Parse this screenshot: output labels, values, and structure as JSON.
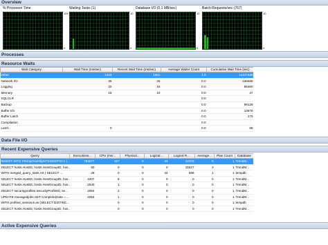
{
  "sections": {
    "overview": "Overview",
    "processes": "Processes",
    "resource_waits": "Resource Waits",
    "data_file_io": "Data File I/O",
    "recent_expensive_queries": "Recent Expensive Queries",
    "active_expensive_queries": "Active Expensive Queries"
  },
  "graphs": [
    {
      "title": "% Processor Time",
      "scale": [
        "100",
        "",
        "",
        "",
        "",
        "",
        "",
        "",
        "",
        "0"
      ],
      "color": "#00cc00"
    },
    {
      "title": "Waiting Tasks (1)",
      "scale": [
        "10",
        "",
        "",
        "",
        "",
        "",
        "",
        "",
        "",
        "0"
      ],
      "color": "#00cc00"
    },
    {
      "title": "Database I/O (0.1 MB/sec)",
      "scale": [
        "10",
        "",
        "",
        "",
        "",
        "",
        "",
        "",
        "",
        "0"
      ],
      "color": "#00cc00"
    },
    {
      "title": "Batch Requests/sec (767)",
      "scale": [
        "10",
        "",
        "",
        "",
        "",
        "",
        "",
        "",
        "",
        "0"
      ],
      "color": "#00cc00"
    }
  ],
  "resource_waits": {
    "columns": [
      "Wait Category",
      "Wait Time (ms/sec)",
      "Recent Wait Time (ms/sec)",
      "Average Waiter Count",
      "Cumulative Wait Time (sec)"
    ],
    "rows": [
      [
        "Other",
        "1003",
        "1001",
        "1.0",
        "12327639"
      ],
      [
        "Network I/O",
        "25",
        "26",
        "0.0",
        "166686"
      ],
      [
        "Logging",
        "20",
        "16",
        "0.0",
        "86480"
      ],
      [
        "Memory",
        "16",
        "10",
        "0.0",
        "47"
      ],
      [
        "SQLCLR",
        "",
        "",
        "0.0",
        ""
      ],
      [
        "Backup",
        "",
        "",
        "0.0",
        "99128"
      ],
      [
        "Buffer I/O",
        "",
        "",
        "0.0",
        "13676"
      ],
      [
        "Buffer Latch",
        "",
        "",
        "0.0",
        "175"
      ],
      [
        "Compilation",
        "",
        "",
        "0.0",
        ""
      ],
      [
        "Latch",
        "0",
        "",
        "0.0",
        "69"
      ]
    ]
  },
  "recent_queries": {
    "columns": [
      "Query",
      "Executions...",
      "CPU (ms/...",
      "Physical...",
      "Logical...",
      "Logical R...",
      "Average...",
      "Plan Count",
      "Database"
    ],
    "rows": [
      [
        "INSERT INTO #TempOneObjINTEGERPOC1 (...",
        "784677",
        "187",
        "0",
        "33",
        "12076",
        "0",
        "1",
        "TrendM..."
      ],
      [
        "SELECT hosts.HostID, hosts.HostGroupID, hos...",
        "60",
        "0",
        "0",
        "0",
        "15627",
        "3",
        "1",
        "TrendM..."
      ],
      [
        "WITH merged_query_stats AS (  SELECT ...",
        "29",
        "0",
        "0",
        "44",
        "598",
        "1",
        "1",
        "tempdb"
      ],
      [
        "SELECT hosts.HostID, hosts.HostGroupID, hos...",
        "3207",
        "8",
        "0",
        "0",
        "0",
        "0",
        "1",
        "TrendM..."
      ],
      [
        "SELECT hosts.HostID, hosts.HostGroupID, hos...",
        "2640",
        "1",
        "0",
        "0",
        "0",
        "0",
        "1",
        "TrendM..."
      ],
      [
        "SELECT securityprofiles.SecurityProfileID, se...",
        "2064",
        "2",
        "0",
        "0",
        "0",
        "0",
        "1",
        "TrendM..."
      ],
      [
        "UPDATE managedjobs SET Complete(Date = ...",
        "2054",
        "1",
        "0",
        "0",
        "0",
        "0",
        "1",
        "TrendM..."
      ],
      [
        "WITH profiled_sessions as (SELECT DISTINC...",
        "",
        "0",
        "0",
        "0",
        "0",
        "0",
        "1",
        "tempdb"
      ],
      [
        "SELECT hosts.HostID, hosts.HostGroupID, hos...",
        "",
        "0",
        "0",
        "0",
        "0",
        "0",
        "1",
        "TrendM..."
      ]
    ]
  }
}
